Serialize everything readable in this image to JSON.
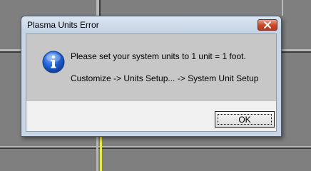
{
  "dialog": {
    "title": "Plasma Units Error",
    "message_line1": "Please set your system units to 1 unit = 1 foot.",
    "message_line2": "Customize -> Units Setup... -> System Unit Setup",
    "ok_label": "OK",
    "icon": "info-icon",
    "close_icon": "close-icon"
  },
  "colors": {
    "viewport_bg": "#7f7f7f",
    "message_bg": "#c7c7c7",
    "footer_bg": "#f0f0f0",
    "close_button": "#c7452a",
    "grid_highlight": "#e8e84a"
  }
}
